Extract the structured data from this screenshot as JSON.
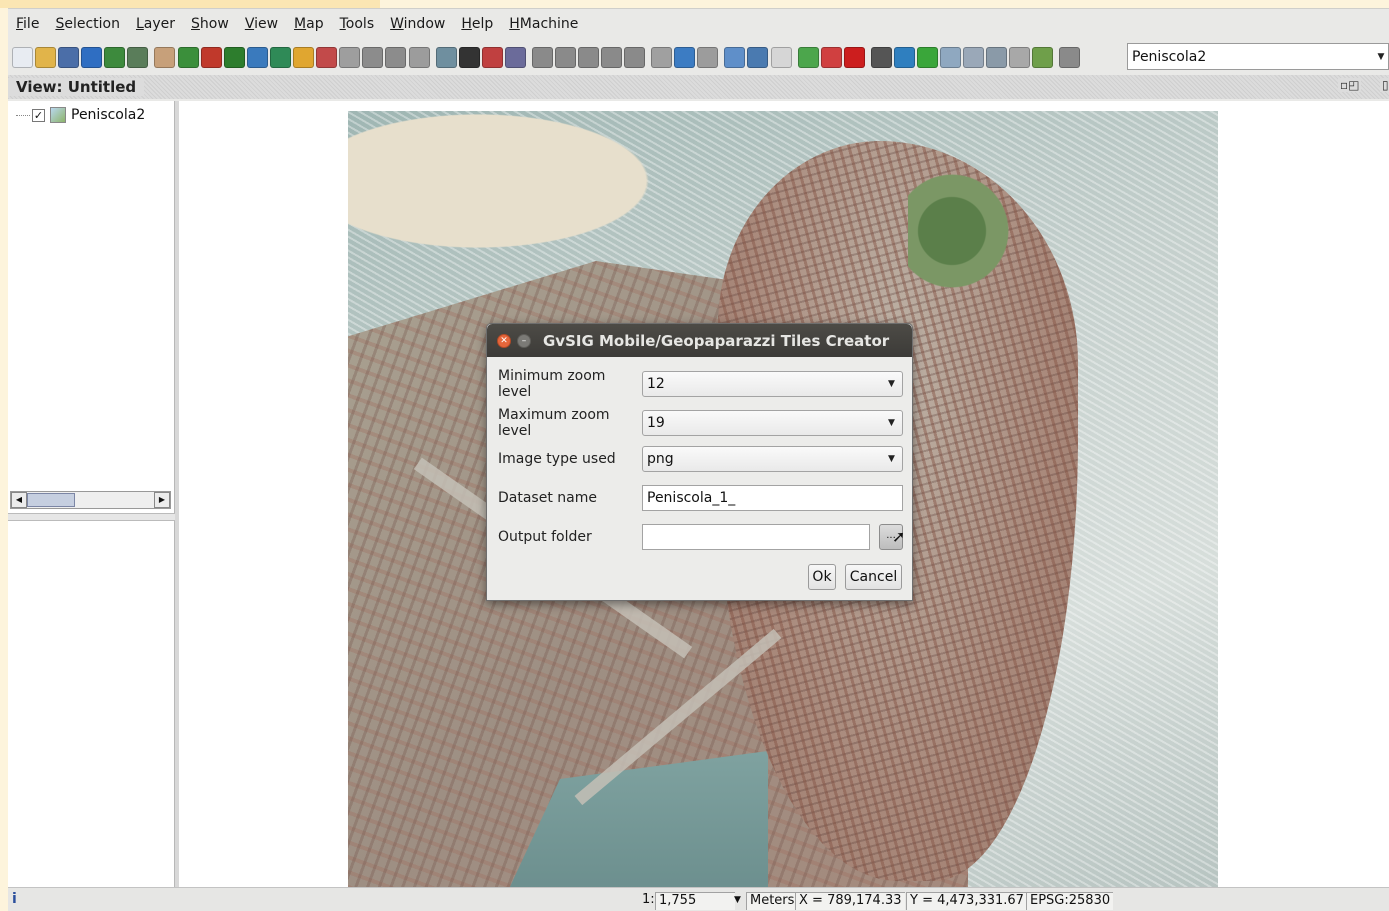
{
  "menu": [
    "File",
    "Selection",
    "Layer",
    "Show",
    "View",
    "Map",
    "Tools",
    "Window",
    "Help",
    "HMachine"
  ],
  "toolbar": {
    "icons": [
      {
        "name": "new-doc-icon",
        "color": "#e8ecf2"
      },
      {
        "name": "open-folder-icon",
        "color": "#e1b44a"
      },
      {
        "name": "save-icon",
        "color": "#4b6ea8"
      },
      {
        "name": "upload-icon",
        "color": "#2f6ec2"
      },
      {
        "name": "add-layer-icon",
        "color": "#3d8a3d"
      },
      {
        "name": "layer-props-icon",
        "color": "#5a7d5a"
      },
      {
        "name": "pan-hand-icon",
        "color": "#c7a07a"
      },
      {
        "name": "zoom-full-icon",
        "color": "#3b8f3b"
      },
      {
        "name": "zoom-extent-icon",
        "color": "#c0392b"
      },
      {
        "name": "zoom-in-icon",
        "color": "#2d7d2d"
      },
      {
        "name": "zoom-out-icon",
        "color": "#3a7abd"
      },
      {
        "name": "layer-stack-icon",
        "color": "#2f8a57"
      },
      {
        "name": "zoom-layer-icon",
        "color": "#e0a630"
      },
      {
        "name": "zoom-select-icon",
        "color": "#c24a4a"
      },
      {
        "name": "zoom-magnify-icon",
        "color": "#9e9e9e"
      },
      {
        "name": "zoom-prev-icon",
        "color": "#8c8c8c"
      },
      {
        "name": "zoom-next-icon",
        "color": "#8c8c8c"
      },
      {
        "name": "zoom-clear-icon",
        "color": "#9c9c9c"
      },
      {
        "name": "measure-icon",
        "color": "#6f8f9f"
      },
      {
        "name": "info-icon",
        "color": "#333333"
      },
      {
        "name": "query-icon",
        "color": "#c04040"
      },
      {
        "name": "print-icon",
        "color": "#6b6b9a"
      },
      {
        "name": "select-point-icon",
        "color": "#8a8a8a"
      },
      {
        "name": "select-rect-icon",
        "color": "#8a8a8a"
      },
      {
        "name": "select-poly-icon",
        "color": "#8a8a8a"
      },
      {
        "name": "select-circle-icon",
        "color": "#8a8a8a"
      },
      {
        "name": "select-line-icon",
        "color": "#8a8a8a"
      },
      {
        "name": "table-icon",
        "color": "#a0a0a0"
      },
      {
        "name": "arrow-icon",
        "color": "#3c7cc3"
      },
      {
        "name": "link-icon",
        "color": "#9c9c9c"
      },
      {
        "name": "copy-icon",
        "color": "#5f8fc9"
      },
      {
        "name": "search-doc-icon",
        "color": "#4a7ab0"
      },
      {
        "name": "blank-icon",
        "color": "#d6d6d6"
      },
      {
        "name": "geo-tool-icon",
        "color": "#4ca64c"
      },
      {
        "name": "target-icon",
        "color": "#d04040"
      },
      {
        "name": "stop-icon",
        "color": "#cc1e1e"
      },
      {
        "name": "tools-icon",
        "color": "#555555"
      },
      {
        "name": "globe-icon",
        "color": "#2f7fbf"
      },
      {
        "name": "green-square-icon",
        "color": "#3aa63a"
      },
      {
        "name": "gear-icon",
        "color": "#8fa8c0"
      },
      {
        "name": "db-icon",
        "color": "#9aa8b8"
      },
      {
        "name": "map-sheet-icon",
        "color": "#8a9aa8"
      },
      {
        "name": "frame-icon",
        "color": "#a8a8a8"
      },
      {
        "name": "layer-tool-icon",
        "color": "#6f9f4a"
      },
      {
        "name": "layer-edit-icon",
        "color": "#8a8a8a"
      }
    ],
    "layer_select_value": "Peniscola2"
  },
  "view": {
    "title": "View: Untitled"
  },
  "toc": {
    "layer_name": "Peniscola2",
    "checked": true
  },
  "dialog": {
    "title": "GvSIG Mobile/Geopaparazzi Tiles Creator",
    "min_zoom_label": "Minimum zoom level",
    "min_zoom_value": "12",
    "max_zoom_label": "Maximum zoom level",
    "max_zoom_value": "19",
    "image_type_label": "Image type used",
    "image_type_value": "png",
    "dataset_label": "Dataset name",
    "dataset_value": "Peniscola_1_",
    "output_label": "Output folder",
    "output_value": "",
    "browse_label": "...",
    "ok_label": "Ok",
    "cancel_label": "Cancel"
  },
  "status": {
    "scale_prefix": "1:",
    "scale_value": "1,755",
    "units": "Meters",
    "x_coord": "X = 789,174.33",
    "y_coord": "Y = 4,473,331.67",
    "epsg": "EPSG:25830"
  }
}
